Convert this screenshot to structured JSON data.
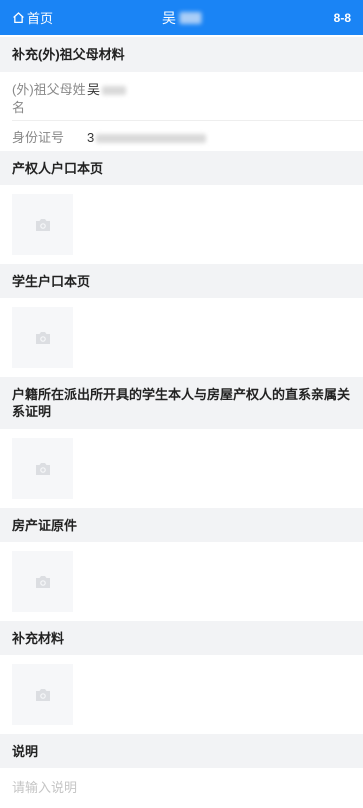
{
  "header": {
    "home_label": "首页",
    "title_visible": "吴",
    "page_indicator": "8-8",
    "accent_color": "#1a84f5"
  },
  "grandparent": {
    "section_title": "补充(外)祖父母材料",
    "name_label": "(外)祖父母姓名",
    "name_value_visible": "吴",
    "id_label": "身份证号",
    "id_value_visible": "3"
  },
  "sections": {
    "property_owner_hukou": "产权人户口本页",
    "student_hukou": "学生户口本页",
    "relation_proof": "户籍所在派出所开具的学生本人与房屋产权人的直系亲属关系证明",
    "property_certificate": "房产证原件",
    "supplementary": "补充材料",
    "notes": "说明"
  },
  "notes": {
    "placeholder": "请输入说明"
  },
  "icons": {
    "home": "home-icon",
    "upload": "camera-icon"
  }
}
